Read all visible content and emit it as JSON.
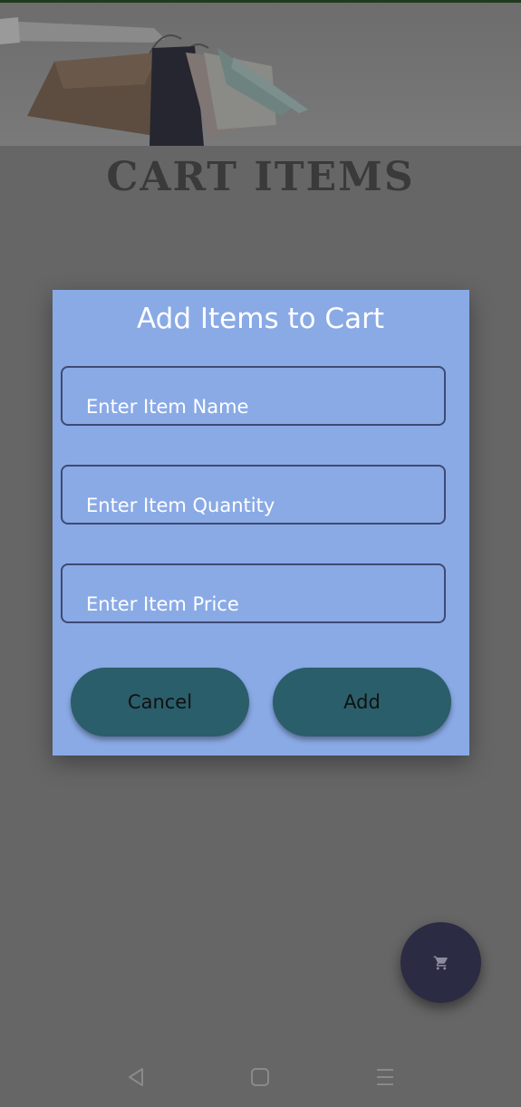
{
  "page": {
    "title": "CART ITEMS"
  },
  "dialog": {
    "title": "Add Items to Cart",
    "fields": {
      "name": {
        "placeholder": "Enter Item Name",
        "value": ""
      },
      "quantity": {
        "placeholder": "Enter Item Quantity",
        "value": ""
      },
      "price": {
        "placeholder": "Enter Item Price",
        "value": ""
      }
    },
    "buttons": {
      "cancel": "Cancel",
      "add": "Add"
    }
  },
  "fab": {
    "icon": "cart-icon"
  },
  "navbar": {
    "icons": [
      "back-icon",
      "home-icon",
      "menu-icon"
    ]
  },
  "colors": {
    "scrim": "#666666",
    "dialog_bg": "#8aaae6",
    "button_bg": "#2a5e6a",
    "fab_bg": "#2b2b44"
  }
}
